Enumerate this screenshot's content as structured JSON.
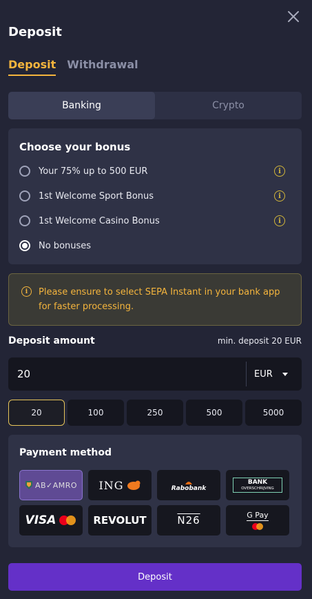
{
  "header": {
    "title": "Deposit"
  },
  "tabs": [
    {
      "label": "Deposit",
      "active": true
    },
    {
      "label": "Withdrawal",
      "active": false
    }
  ],
  "method_toggle": [
    {
      "label": "Banking",
      "active": true
    },
    {
      "label": "Crypto",
      "active": false
    }
  ],
  "bonus": {
    "title": "Choose your bonus",
    "options": [
      {
        "label": "Your 75% up to 500 EUR",
        "selected": false,
        "has_info": true
      },
      {
        "label": "1st Welcome Sport Bonus",
        "selected": false,
        "has_info": true
      },
      {
        "label": "1st Welcome Casino Bonus",
        "selected": false,
        "has_info": true
      },
      {
        "label": "No bonuses",
        "selected": true,
        "has_info": false
      }
    ]
  },
  "notice": {
    "text": "Please ensure to select SEPA Instant in your bank app for faster processing.",
    "icon": "info-icon"
  },
  "amount": {
    "label": "Deposit amount",
    "min_text": "min. deposit 20 EUR",
    "value": "20",
    "currency": "EUR",
    "quick_values": [
      "20",
      "100",
      "250",
      "500",
      "5000"
    ],
    "selected": "20"
  },
  "payment": {
    "title": "Payment method",
    "methods": [
      {
        "name": "ABN AMRO",
        "display": "AB✓AMRO",
        "selected": true
      },
      {
        "name": "ING",
        "display": "ING",
        "selected": false
      },
      {
        "name": "Rabobank",
        "display": "Rabobank",
        "selected": false
      },
      {
        "name": "Bank Overschrijving",
        "display_line1": "BANK",
        "display_line2": "OVERSCHRIJVING",
        "selected": false
      },
      {
        "name": "Visa Mastercard",
        "display": "VISA",
        "selected": false
      },
      {
        "name": "Revolut",
        "display": "REVOLUT",
        "selected": false
      },
      {
        "name": "N26",
        "display": "N26",
        "selected": false
      },
      {
        "name": "Google Pay",
        "display": "G Pay",
        "selected": false
      }
    ]
  },
  "submit": {
    "label": "Deposit"
  },
  "colors": {
    "background": "#232536",
    "accent": "#f5b53d",
    "primary_button": "#6430c8",
    "panel": "#2f3246"
  }
}
